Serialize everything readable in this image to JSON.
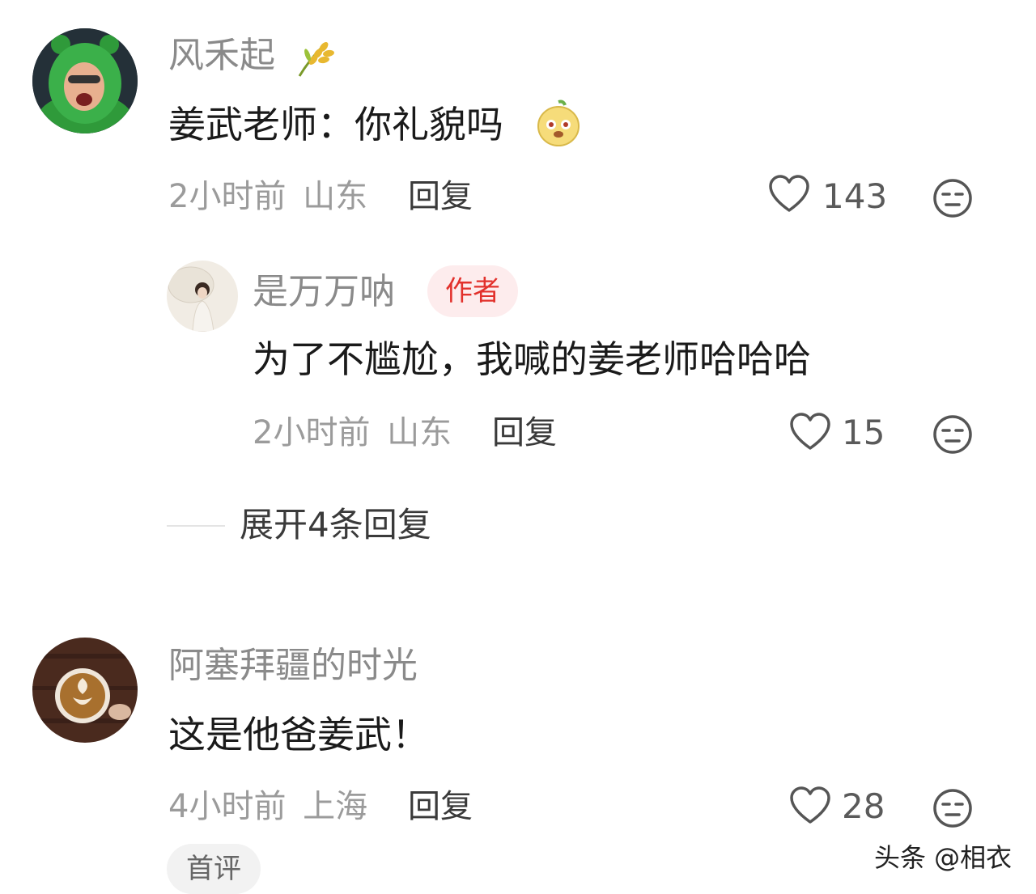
{
  "comments": [
    {
      "username": "风禾起",
      "text": "姜武老师：你礼貌吗",
      "time": "2小时前",
      "location": "山东",
      "reply_label": "回复",
      "likes": "143"
    },
    {
      "username": "阿塞拜疆的时光",
      "text": "这是他爸姜武！",
      "time": "4小时前",
      "location": "上海",
      "reply_label": "回复",
      "likes": "28",
      "badge": "首评"
    }
  ],
  "reply": {
    "username": "是万万呐",
    "author_badge": "作者",
    "text": "为了不尴尬，我喊的姜老师哈哈哈",
    "time": "2小时前",
    "location": "山东",
    "reply_label": "回复",
    "likes": "15"
  },
  "expand_replies": "展开4条回复",
  "watermark": "头条 @相衣",
  "colors": {
    "author_badge": "#e2312c",
    "meta": "#9b9b9b"
  }
}
